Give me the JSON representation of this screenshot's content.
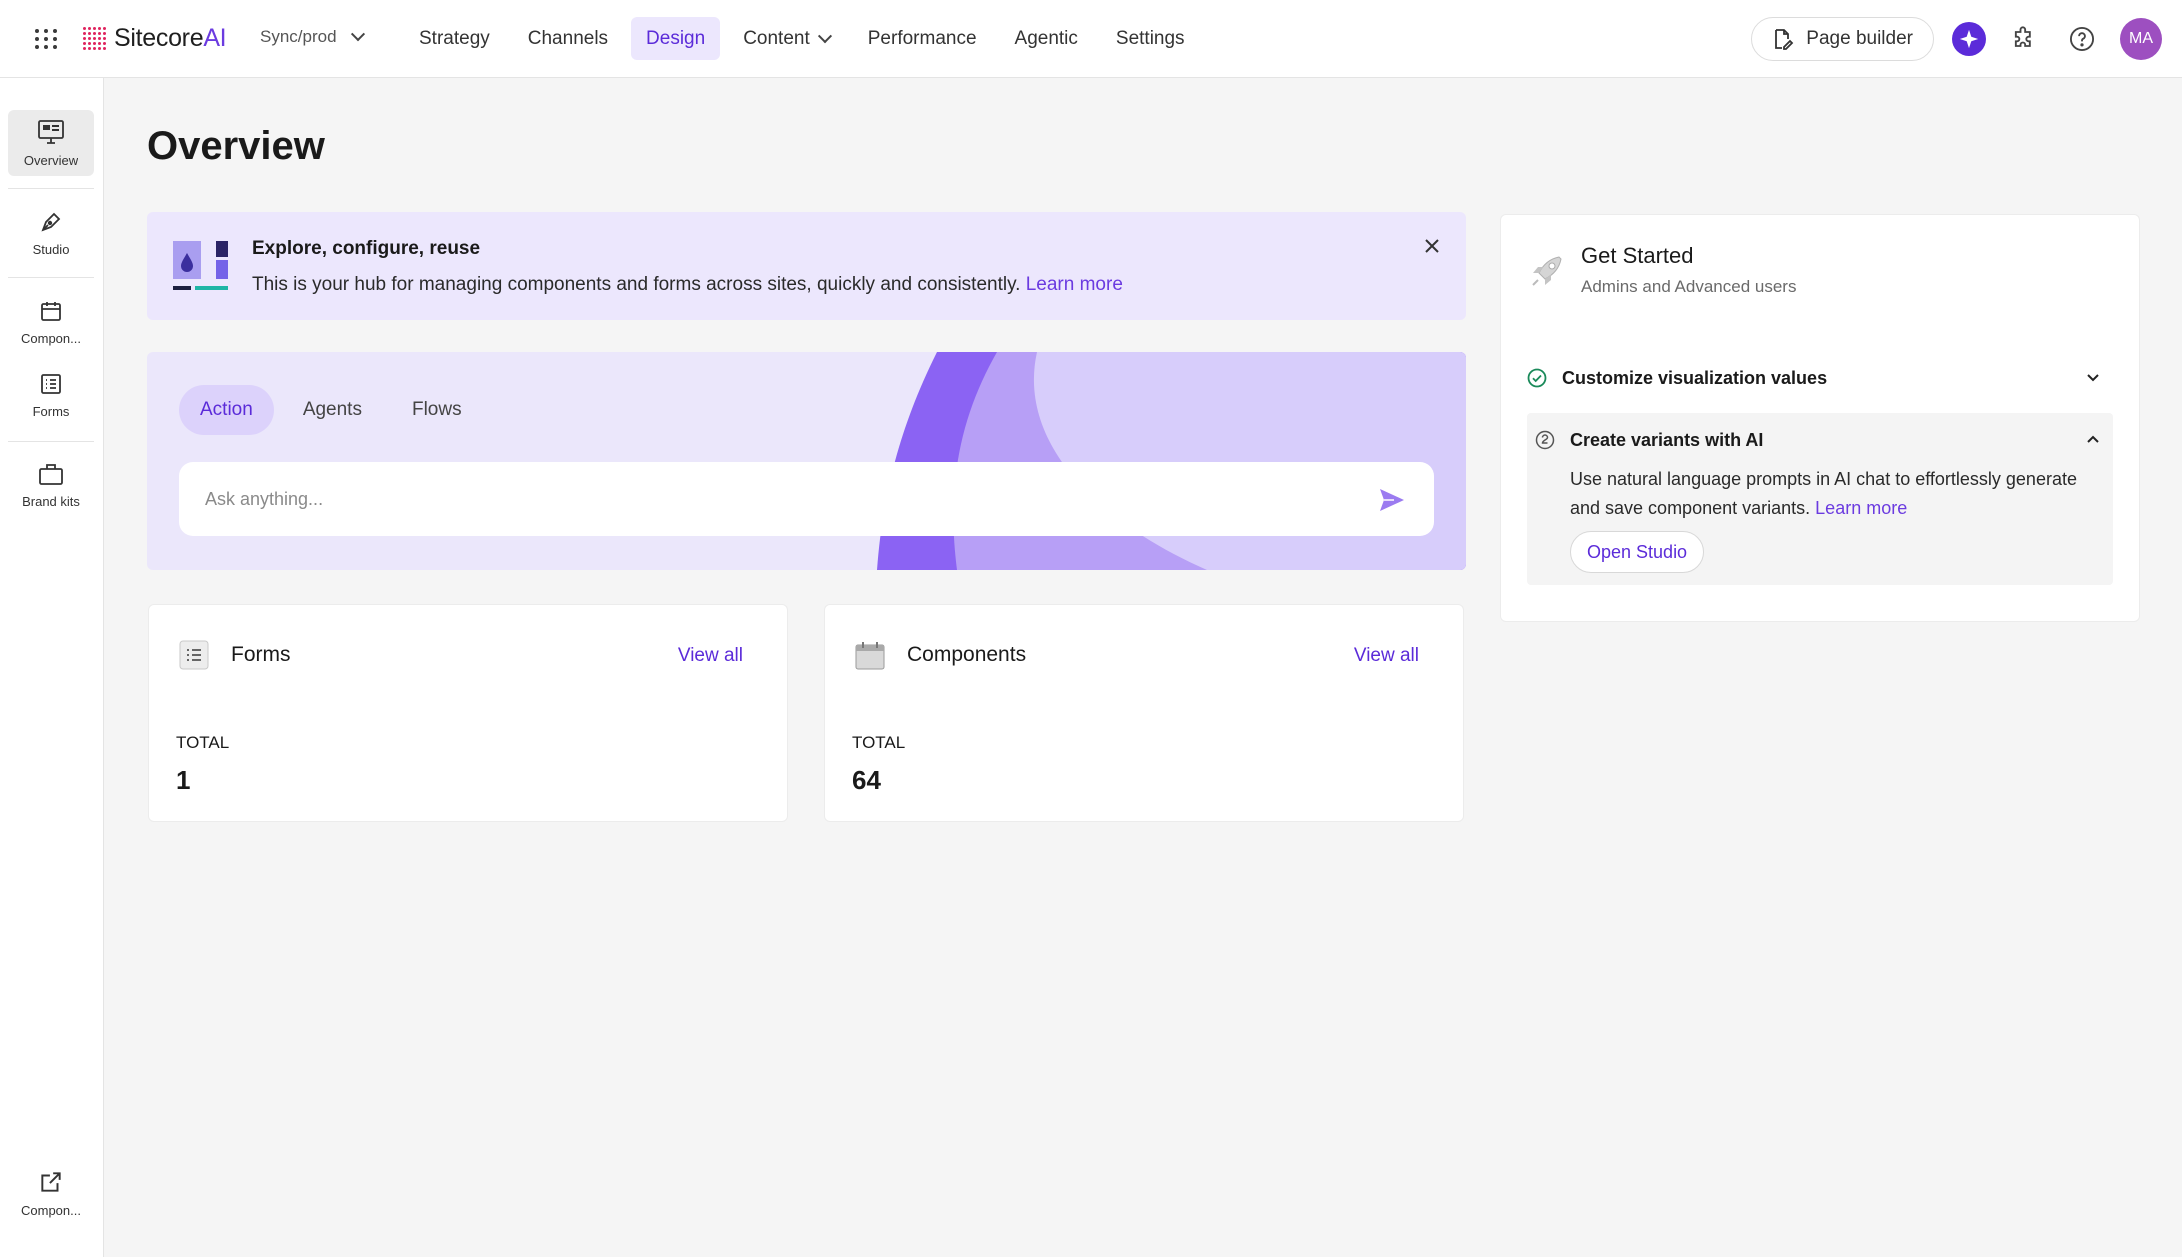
{
  "header": {
    "brand_name": "Sitecore",
    "brand_suffix": "AI",
    "environment": "Sync/prod",
    "nav": [
      {
        "label": "Strategy",
        "active": false
      },
      {
        "label": "Channels",
        "active": false
      },
      {
        "label": "Design",
        "active": true
      },
      {
        "label": "Content",
        "active": false,
        "has_dropdown": true
      },
      {
        "label": "Performance",
        "active": false
      },
      {
        "label": "Agentic",
        "active": false
      },
      {
        "label": "Settings",
        "active": false
      }
    ],
    "page_builder_label": "Page builder",
    "avatar_initials": "MA",
    "accent_color": "#5b2bd9"
  },
  "sidebar": {
    "items": [
      {
        "label": "Overview",
        "icon": "overview-icon",
        "active": true
      },
      {
        "label": "Studio",
        "icon": "pen-icon",
        "active": false
      },
      {
        "label": "Compon...",
        "icon": "calendar-icon",
        "active": false
      },
      {
        "label": "Forms",
        "icon": "list-icon",
        "active": false
      },
      {
        "label": "Brand kits",
        "icon": "briefcase-icon",
        "active": false
      }
    ],
    "bottom_item": {
      "label": "Compon...",
      "icon": "external-link-icon"
    }
  },
  "main": {
    "title": "Overview",
    "banner": {
      "title": "Explore, configure, reuse",
      "text": "This is your hub for managing components and forms across sites, quickly and consistently.",
      "link": "Learn more"
    },
    "ask": {
      "tabs": [
        {
          "label": "Action",
          "active": true
        },
        {
          "label": "Agents",
          "active": false
        },
        {
          "label": "Flows",
          "active": false
        }
      ],
      "placeholder": "Ask anything..."
    },
    "cards": [
      {
        "title": "Forms",
        "view_all": "View all",
        "total_label": "TOTAL",
        "total": "1",
        "icon": "list-icon"
      },
      {
        "title": "Components",
        "view_all": "View all",
        "total_label": "TOTAL",
        "total": "64",
        "icon": "calendar-icon"
      }
    ]
  },
  "get_started": {
    "title": "Get Started",
    "subtitle": "Admins and Advanced users",
    "items": [
      {
        "title": "Customize visualization values",
        "status": "completed",
        "expanded": false
      },
      {
        "title": "Create variants with AI",
        "status": "pending",
        "expanded": true,
        "body": "Use natural language prompts in AI chat to effortlessly generate and save component variants.",
        "link": "Learn more",
        "action": "Open Studio"
      }
    ]
  }
}
